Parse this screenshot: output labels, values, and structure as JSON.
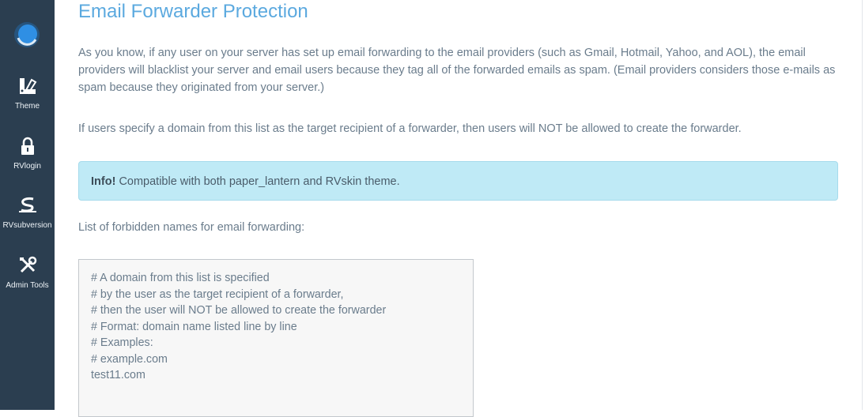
{
  "sidebar": {
    "items": [
      {
        "label": "Theme",
        "icon": "theme-palette-icon"
      },
      {
        "label": "RVlogin",
        "icon": "lock-icon"
      },
      {
        "label": "RVsubversion",
        "icon": "subversion-icon"
      },
      {
        "label": "Admin Tools",
        "icon": "tools-icon"
      }
    ]
  },
  "page": {
    "title": "Email Forwarder Protection",
    "intro": "As you know, if any user on your server has set up email forwarding to the email providers (such as Gmail, Hotmail, Yahoo, and AOL), the email providers will blacklist your server and email users because they tag all of the forwarded emails as spam. (Email providers considers those e-mails as spam because they originated from your server.)",
    "rule": "If users specify a domain from this list as the target recipient of a forwarder, then users will NOT be allowed to create the forwarder.",
    "alert_strong": "Info!",
    "alert_text": "Compatible with both paper_lantern and RVskin theme.",
    "list_label": "List of forbidden names for email forwarding:",
    "editor_lines": [
      "# A domain from this list is specified",
      "# by the user as the target recipient of a forwarder,",
      "# then the user will NOT be allowed to create the forwarder",
      "# Format: domain name listed line by line",
      "# Examples:",
      "# example.com",
      "test11.com"
    ]
  },
  "colors": {
    "sidebar_bg": "#2b3e50",
    "title": "#5ba9df",
    "body_text": "#6a7c8c",
    "alert_bg": "#bfeaf6"
  }
}
